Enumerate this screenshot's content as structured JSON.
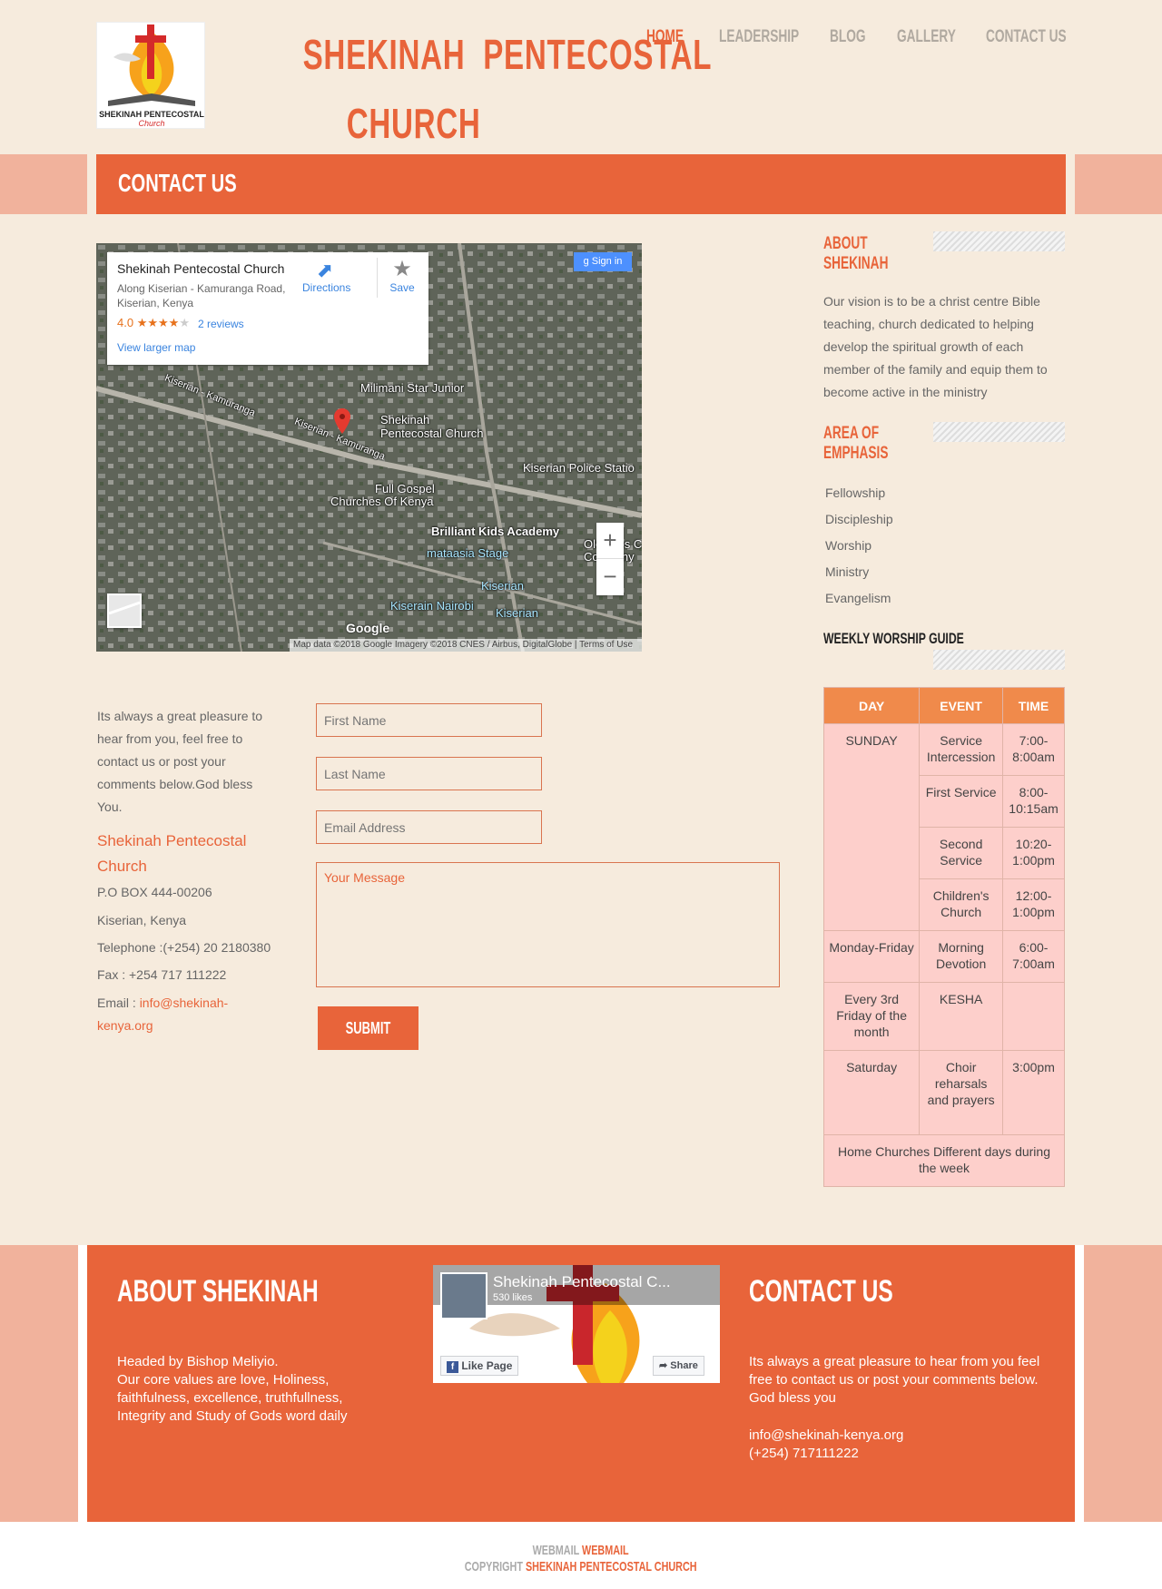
{
  "site": {
    "title_line1": "SHEKINAH  PENTECOSTAL",
    "title_line2": "CHURCH",
    "logo_text": "SHEKINAH PENTECOSTAL",
    "logo_sub": "Church"
  },
  "nav": [
    "HOME",
    "LEADERSHIP",
    "BLOG",
    "GALLERY",
    "CONTACT US"
  ],
  "banner": {
    "title": "CONTACT US"
  },
  "map": {
    "place": "Shekinah Pentecostal Church",
    "address1": "Along Kiserian - Kamuranga Road,",
    "address2": "Kiserian, Kenya",
    "rating": "4.0",
    "stars": "★★★★",
    "reviews": "2 reviews",
    "larger": "View larger map",
    "directions": "Directions",
    "save": "Save",
    "signin": "Sign in",
    "labels": [
      "Milimani Star Junior",
      "Kiserian - Kamuranga",
      "Kiserian - Kamuranga",
      "Shekinah",
      "Pentecostal Church",
      "Kiserian Police Statio",
      "Full Gospel",
      "Churches Of Kenya",
      "Brilliant Kids Academy",
      "mataasia Stage",
      "Olepolos C",
      "Company",
      "Kiserian",
      "Kiserain Nairobi",
      "Kiserian"
    ],
    "attribution": "Map data ©2018 Google Imagery ©2018 CNES / Airbus, DigitalGlobe",
    "terms": "Terms of Use",
    "google": "Google"
  },
  "contact": {
    "intro": "Its always a great pleasure to hear from you, feel free to contact us or post your comments below.God bless You.",
    "name": "Shekinah Pentecostal Church",
    "box": "P.O BOX 444-00206",
    "city": "Kiserian, Kenya",
    "phone": "Telephone :(+254) 20 2180380",
    "fax": "Fax : +254 717 111222",
    "email_label": "Email : ",
    "email": "info@shekinah-kenya.org"
  },
  "form": {
    "first": "First Name",
    "last": "Last Name",
    "email": "Email Address",
    "message": "Your Message",
    "submit": "SUBMIT"
  },
  "sidebar": {
    "about_h1": "ABOUT",
    "about_h2": "SHEKINAH",
    "about_text": "Our vision is to be a christ centre Bible teaching, church dedicated to helping develop the spiritual growth of each member of the family and equip them to become active in the ministry",
    "emph_h1": "AREA OF",
    "emph_h2": "EMPHASIS",
    "emphasis": [
      "Fellowship",
      "Discipleship",
      "Worship",
      "Ministry",
      "Evangelism"
    ],
    "guide_h": "WEEKLY WORSHIP GUIDE"
  },
  "worship": {
    "headers": [
      "DAY",
      "EVENT",
      "TIME"
    ],
    "sunday": "SUNDAY",
    "sunday_rows": [
      [
        "Service Intercession",
        "7:00-8:00am"
      ],
      [
        "First Service",
        "8:00-10:15am"
      ],
      [
        "Second Service",
        "10:20-1:00pm"
      ],
      [
        "Children's Church",
        "12:00-1:00pm"
      ]
    ],
    "weekday": [
      "Monday-Friday",
      "Morning Devotion",
      "6:00-7:00am"
    ],
    "friday": [
      "Every 3rd Friday of the month",
      "KESHA",
      ""
    ],
    "saturday": [
      "Saturday",
      "Choir reharsals and prayers",
      "3:00pm"
    ],
    "home": "Home Churches Different days during the week"
  },
  "footer": {
    "about_h": "ABOUT SHEKINAH",
    "about_l1": "Headed by Bishop Meliyio.",
    "about_l2": "Our core values are love, Holiness, faithfulness, excellence, truthfullness, Integrity and Study of Gods word daily",
    "fb_name": "Shekinah Pentecostal C...",
    "fb_likes": "530 likes",
    "fb_like": "Like Page",
    "fb_share": "Share",
    "contact_h": "CONTACT US",
    "contact_t": "Its always a great pleasure to hear from you feel free to contact us or post your comments below. God bless you",
    "contact_email": "info@shekinah-kenya.org",
    "contact_phone": "(+254) 717111222"
  },
  "bottom": {
    "webmail_a": "WEBMAIL ",
    "webmail_b": "WEBMAIL",
    "copy_a": "COPYRIGHT ",
    "copy_b": "SHEKINAH PENTECOSTAL CHURCH"
  },
  "colors": {
    "accent": "#e8643a",
    "banner_side": "#f1b29c",
    "table_head": "#f08a4b",
    "table_cell": "#fdcfcb"
  }
}
